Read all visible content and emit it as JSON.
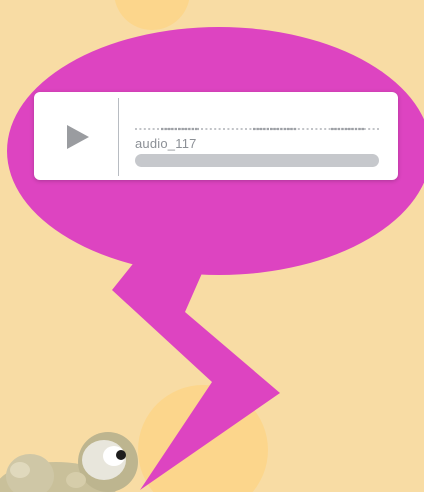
{
  "colors": {
    "background": "#f8dca4",
    "sun_circles": "#fcd68c",
    "speech_bubble": "#dd44c1",
    "player_bg": "#ffffff",
    "play_icon": "#9a9ca0",
    "progress_track": "#c6c8cc"
  },
  "audio_player": {
    "track_name": "audio_117",
    "play_icon": "play-triangle-icon",
    "progress": 0
  },
  "character": {
    "icon": "frog-character-icon"
  }
}
